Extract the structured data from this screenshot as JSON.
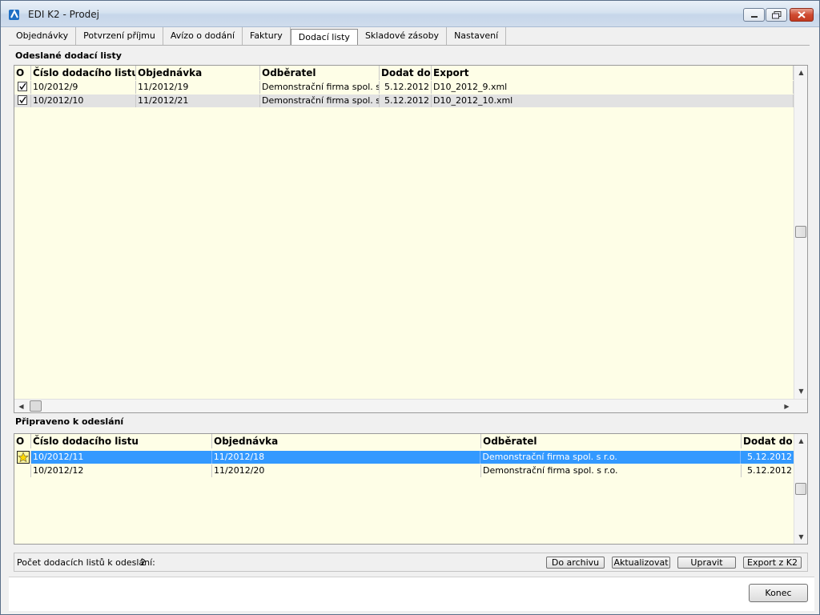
{
  "window": {
    "title": "EDI K2 - Prodej"
  },
  "tabs": [
    {
      "label": "Objednávky"
    },
    {
      "label": "Potvrzení příjmu"
    },
    {
      "label": "Avízo o dodání"
    },
    {
      "label": "Faktury"
    },
    {
      "label": "Dodací listy",
      "active": true
    },
    {
      "label": "Skladové zásoby"
    },
    {
      "label": "Nastavení"
    }
  ],
  "sent": {
    "title": "Odeslané dodací listy",
    "columns": [
      "O",
      "Číslo dodacího listu",
      "Objednávka",
      "Odběratel",
      "Dodat do",
      "Export"
    ],
    "rows": [
      {
        "icon": "check-icon",
        "cislo": "10/2012/9",
        "objednavka": "11/2012/19",
        "odberatel": "Demonstrační firma spol. s ...",
        "dodat": "5.12.2012",
        "export": "D10_2012_9.xml"
      },
      {
        "icon": "check-icon",
        "cislo": "10/2012/10",
        "objednavka": "11/2012/21",
        "odberatel": "Demonstrační firma spol. s ...",
        "dodat": "5.12.2012",
        "export": "D10_2012_10.xml"
      }
    ]
  },
  "ready": {
    "title": "Připraveno k odeslání",
    "columns": [
      "O",
      "Číslo dodacího listu",
      "Objednávka",
      "Odběratel",
      "Dodat do"
    ],
    "rows": [
      {
        "icon": "star-icon",
        "cislo": "10/2012/11",
        "objednavka": "11/2012/18",
        "odberatel": "Demonstrační firma spol. s r.o.",
        "dodat": "5.12.2012",
        "selected": true
      },
      {
        "icon": "",
        "cislo": "10/2012/12",
        "objednavka": "11/2012/20",
        "odberatel": "Demonstrační firma spol. s r.o.",
        "dodat": "5.12.2012"
      }
    ]
  },
  "footer": {
    "count_label": "Počet dodacích listů k odeslání:",
    "count_value": "2",
    "buttons": [
      "Do archivu",
      "Aktualizovat",
      "Upravit",
      "Export z K2"
    ]
  },
  "close_button": "Konec",
  "colors": {
    "grid_bg": "#fefee7",
    "selection": "#3399ff",
    "alt_row": "#e2e2e2"
  }
}
